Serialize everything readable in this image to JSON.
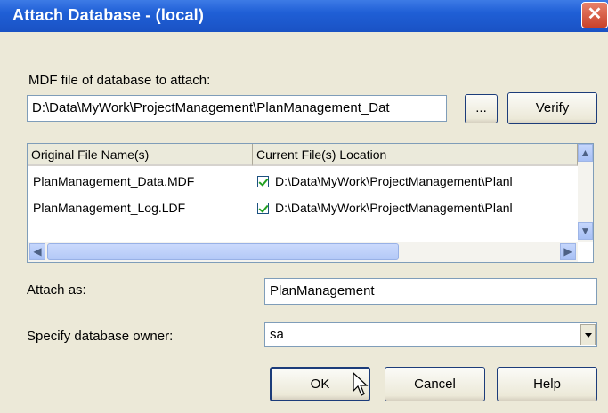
{
  "window": {
    "title": "Attach Database - (local)",
    "close_glyph": "✕"
  },
  "mdf": {
    "label": "MDF file of database to attach:",
    "path": "D:\\Data\\MyWork\\ProjectManagement\\PlanManagement_Dat",
    "browse_label": "...",
    "verify_label": "Verify"
  },
  "files_table": {
    "columns": [
      "Original File Name(s)",
      "Current File(s) Location"
    ],
    "rows": [
      {
        "name": "PlanManagement_Data.MDF",
        "checked": true,
        "location": "D:\\Data\\MyWork\\ProjectManagement\\Planl"
      },
      {
        "name": "PlanManagement_Log.LDF",
        "checked": true,
        "location": "D:\\Data\\MyWork\\ProjectManagement\\Planl"
      }
    ]
  },
  "attach_as": {
    "label": "Attach as:",
    "value": "PlanManagement"
  },
  "owner": {
    "label": "Specify database owner:",
    "value": "sa"
  },
  "buttons": {
    "ok": "OK",
    "cancel": "Cancel",
    "help": "Help"
  }
}
